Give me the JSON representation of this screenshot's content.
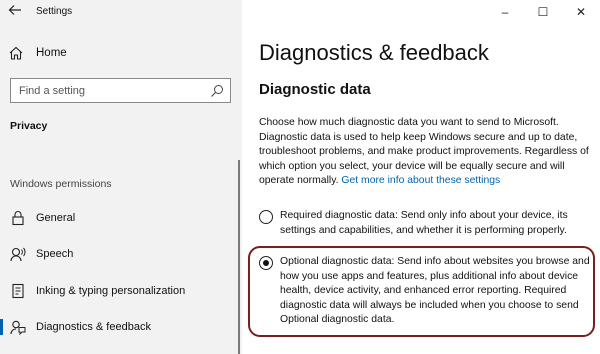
{
  "window": {
    "app_title": "Settings",
    "controls": {
      "minimize": "–",
      "maximize": "☐",
      "close": "✕"
    }
  },
  "sidebar": {
    "home_label": "Home",
    "search_placeholder": "Find a setting",
    "section_title": "Privacy",
    "group_title": "Windows permissions",
    "items": [
      {
        "label": "General",
        "icon": "lock-icon"
      },
      {
        "label": "Speech",
        "icon": "speech-icon"
      },
      {
        "label": "Inking & typing personalization",
        "icon": "inking-icon"
      },
      {
        "label": "Diagnostics & feedback",
        "icon": "feedback-icon",
        "selected": true
      }
    ],
    "accent_color": "#0063b1"
  },
  "main": {
    "page_title": "Diagnostics & feedback",
    "section_title": "Diagnostic data",
    "description": "Choose how much diagnostic data you want to send to Microsoft. Diagnostic data is used to help keep Windows secure and up to date, troubleshoot problems, and make product improvements. Regardless of which option you select, your device will be equally secure and will operate normally.",
    "link_text": "Get more info about these settings",
    "options": [
      {
        "label": "Required diagnostic data: Send only info about your device, its settings and capabilities, and whether it is performing properly.",
        "checked": false
      },
      {
        "label": "Optional diagnostic data: Send info about websites you browse and how you use apps and features, plus additional info about device health, device activity, and enhanced error reporting. Required diagnostic data will always be included when you choose to send Optional diagnostic data.",
        "checked": true
      }
    ],
    "highlight_color": "#7a1f1f"
  }
}
